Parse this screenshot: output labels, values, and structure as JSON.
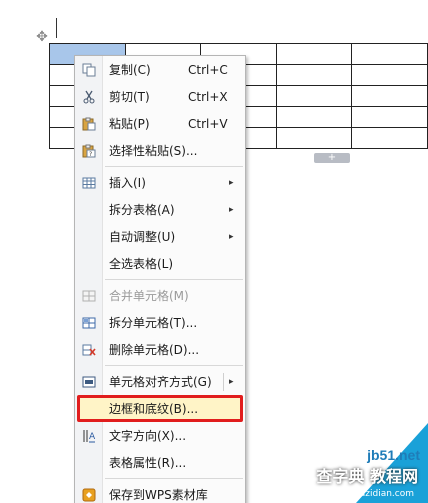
{
  "menu": {
    "items": [
      {
        "label": "复制(C)",
        "shortcut": "Ctrl+C",
        "icon": "copy-icon"
      },
      {
        "label": "剪切(T)",
        "shortcut": "Ctrl+X",
        "icon": "scissors-icon"
      },
      {
        "label": "粘贴(P)",
        "shortcut": "Ctrl+V",
        "icon": "clipboard-icon"
      },
      {
        "label": "选择性粘贴(S)...",
        "icon": "paste-special-icon"
      },
      {
        "label": "插入(I)",
        "icon": "table-insert-icon",
        "submenu": true
      },
      {
        "label": "拆分表格(A)",
        "submenu": true
      },
      {
        "label": "自动调整(U)",
        "submenu": true
      },
      {
        "label": "全选表格(L)"
      },
      {
        "label": "合并单元格(M)",
        "icon": "merge-cells-icon",
        "disabled": true
      },
      {
        "label": "拆分单元格(T)...",
        "icon": "split-cells-icon"
      },
      {
        "label": "删除单元格(D)...",
        "icon": "delete-cells-icon"
      },
      {
        "label": "单元格对齐方式(G)",
        "icon": "cell-align-icon",
        "submenu": true
      },
      {
        "label": "边框和底纹(B)...",
        "highlighted": true
      },
      {
        "label": "文字方向(X)...",
        "icon": "text-direction-icon"
      },
      {
        "label": "表格属性(R)..."
      },
      {
        "label": "保存到WPS素材库",
        "icon": "wps-library-icon"
      }
    ],
    "arrow": "▸"
  },
  "table": {
    "add_row": "+"
  },
  "watermark": {
    "site": "jb51.net",
    "text": "查字典 教程网",
    "url": "jiaocheng.chazidian.com"
  },
  "colors": {
    "highlight_border": "#e11d1d",
    "selected_cell": "#a8c6ea"
  }
}
